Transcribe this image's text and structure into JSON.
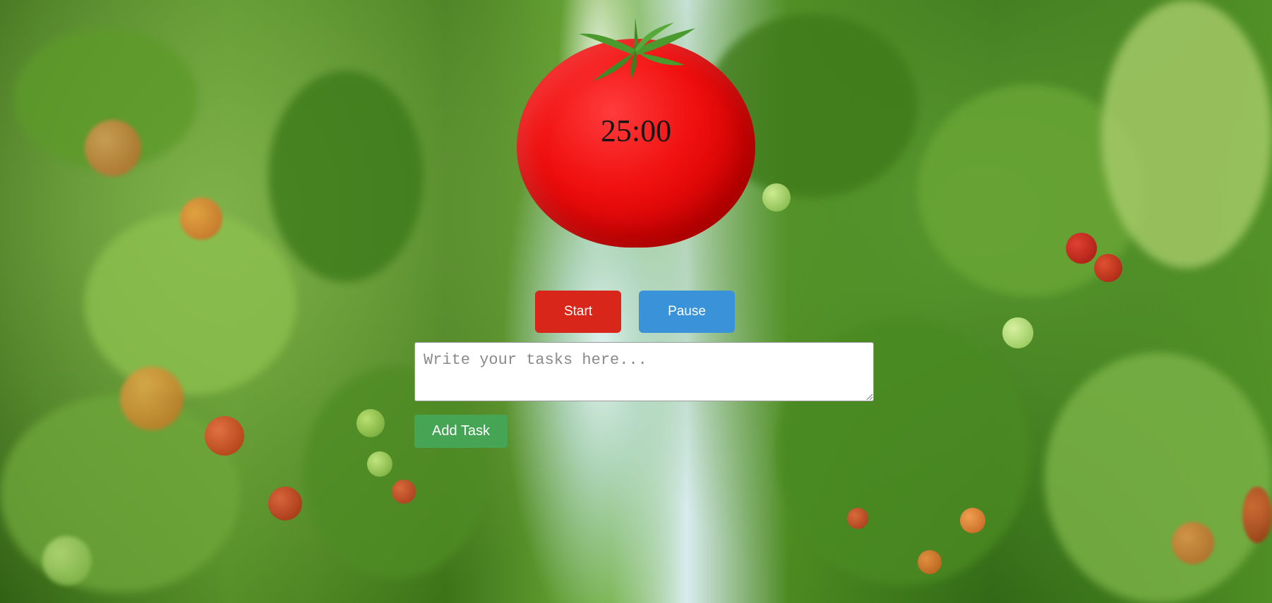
{
  "timer": {
    "display": "25:00"
  },
  "controls": {
    "start_label": "Start",
    "pause_label": "Pause",
    "start_color": "#d8261a",
    "pause_color": "#3a93d8"
  },
  "task_input": {
    "placeholder": "Write your tasks here...",
    "value": ""
  },
  "add_task": {
    "label": "Add Task",
    "color": "#45a554"
  },
  "theme": {
    "tomato_color": "#e80000",
    "background": "greenhouse-tomato-vines"
  },
  "icons": [
    "tomato-stem-icon",
    "resize-grip-icon"
  ]
}
